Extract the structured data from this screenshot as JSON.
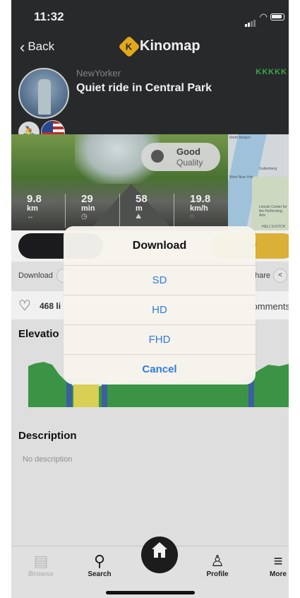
{
  "status_bar": {
    "time": "11:32"
  },
  "nav": {
    "back_label": "Back",
    "app_name": "Kinomap"
  },
  "ride": {
    "author": "NewYorker",
    "title": "Quiet ride in Central Park",
    "level_marks": "KKKKK",
    "quality_label": "Good",
    "quality_sub": "Quality",
    "stats": [
      {
        "value": "9.8",
        "unit": "km",
        "icon": "↔"
      },
      {
        "value": "29",
        "unit": "min",
        "icon": "◷"
      },
      {
        "value": "58",
        "unit": "m",
        "icon": "⛰"
      },
      {
        "value": "19.8",
        "unit": "km/h",
        "icon": "◌"
      }
    ]
  },
  "map_labels": {
    "north_bergen": "North Bergen",
    "guttenberg": "Guttenberg",
    "west_new_york": "West New York",
    "lincoln_center": "Lincoln Center for the Performing Arts",
    "hells_kitchen": "HELL'S KITCH"
  },
  "actions": {
    "secondary_label": "v",
    "download_label": "Download",
    "share_label": "Share"
  },
  "social": {
    "likes": "468 li",
    "comments": "comments"
  },
  "sections": {
    "elevation_title": "Elevatio",
    "description_title": "Description",
    "description_text": "No description"
  },
  "download_sheet": {
    "title": "Download",
    "options": [
      "SD",
      "HD",
      "FHD"
    ],
    "cancel": "Cancel",
    "accent_color": "#2f7be0"
  },
  "tabbar": {
    "items": [
      {
        "label": "Browse",
        "icon": "browse-icon"
      },
      {
        "label": "Search",
        "icon": "search-icon"
      },
      {
        "label": "",
        "icon": "home-icon"
      },
      {
        "label": "Profile",
        "icon": "profile-icon"
      },
      {
        "label": "More",
        "icon": "menu-icon"
      }
    ]
  },
  "colors": {
    "header_bg": "#2b2c2e",
    "brand_yellow": "#f2b31c",
    "elevation_green": "#3f9e4a"
  }
}
